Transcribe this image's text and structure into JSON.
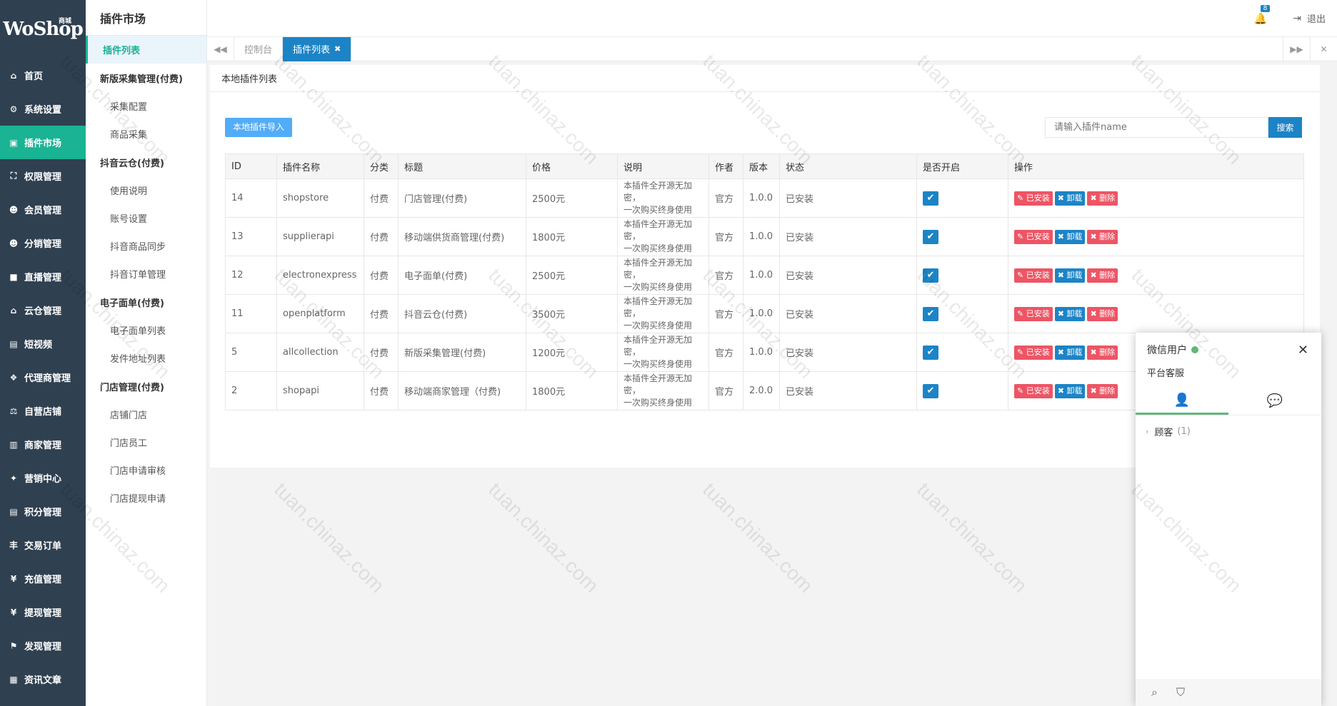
{
  "nav": {
    "logo": "WoShop",
    "logo_tag": "商城",
    "items": [
      {
        "label": "首页",
        "icon": "home-icon",
        "glyph": "⌂"
      },
      {
        "label": "系统设置",
        "icon": "gear-icon",
        "glyph": "⚙"
      },
      {
        "label": "插件市场",
        "icon": "plugin-icon",
        "glyph": "▣"
      },
      {
        "label": "权限管理",
        "icon": "sitemap-icon",
        "glyph": "⛶"
      },
      {
        "label": "会员管理",
        "icon": "users-icon",
        "glyph": "☻"
      },
      {
        "label": "分销管理",
        "icon": "users-icon",
        "glyph": "☻"
      },
      {
        "label": "直播管理",
        "icon": "video-icon",
        "glyph": "■"
      },
      {
        "label": "云仓管理",
        "icon": "home-icon",
        "glyph": "⌂"
      },
      {
        "label": "短视频",
        "icon": "file-icon",
        "glyph": "▤"
      },
      {
        "label": "代理商管理",
        "icon": "cubes-icon",
        "glyph": "❖"
      },
      {
        "label": "自营店铺",
        "icon": "balance-icon",
        "glyph": "⚖"
      },
      {
        "label": "商家管理",
        "icon": "bank-icon",
        "glyph": "▥"
      },
      {
        "label": "营销中心",
        "icon": "tag-icon",
        "glyph": "✦"
      },
      {
        "label": "积分管理",
        "icon": "file-icon",
        "glyph": "▤"
      },
      {
        "label": "交易订单",
        "icon": "yen-icon",
        "glyph": "丰"
      },
      {
        "label": "充值管理",
        "icon": "yen-icon",
        "glyph": "¥"
      },
      {
        "label": "提现管理",
        "icon": "yen-icon",
        "glyph": "¥"
      },
      {
        "label": "发现管理",
        "icon": "flag-icon",
        "glyph": "⚑"
      },
      {
        "label": "资讯文章",
        "icon": "newspaper-icon",
        "glyph": "▦"
      }
    ]
  },
  "submenu": {
    "title": "插件市场",
    "active": "插件列表",
    "groups": [
      {
        "title": "新版采集管理(付费)",
        "items": [
          "采集配置",
          "商品采集"
        ]
      },
      {
        "title": "抖音云仓(付费)",
        "items": [
          "使用说明",
          "账号设置",
          "抖音商品同步",
          "抖音订单管理"
        ]
      },
      {
        "title": "电子面单(付费)",
        "items": [
          "电子面单列表",
          "发件地址列表"
        ]
      },
      {
        "title": "门店管理(付费)",
        "items": [
          "店铺门店",
          "门店员工",
          "门店申请审核",
          "门店提现申请"
        ]
      }
    ]
  },
  "topbar": {
    "badge": "8",
    "logout": "退出"
  },
  "tabs": [
    {
      "label": "控制台"
    },
    {
      "label": "插件列表"
    }
  ],
  "content": {
    "title": "本地插件列表",
    "import_button": "本地插件导入",
    "search_placeholder": "请输入插件name",
    "search_button": "搜索",
    "columns": [
      "ID",
      "插件名称",
      "分类",
      "标题",
      "价格",
      "说明",
      "作者",
      "版本",
      "状态",
      "是否开启",
      "操作"
    ],
    "actions": {
      "installed": "已安装",
      "uninstall": "卸载",
      "delete": "删除"
    },
    "rows": [
      {
        "id": "14",
        "name": "shopstore",
        "cat": "付费",
        "title": "门店管理(付费)",
        "price": "2500元",
        "desc1": "本插件全开源无加密，",
        "desc2": "一次购买终身使用",
        "author": "官方",
        "version": "1.0.0",
        "status": "已安装"
      },
      {
        "id": "13",
        "name": "supplierapi",
        "cat": "付费",
        "title": "移动端供货商管理(付费)",
        "price": "1800元",
        "desc1": "本插件全开源无加密，",
        "desc2": "一次购买终身使用",
        "author": "官方",
        "version": "1.0.0",
        "status": "已安装"
      },
      {
        "id": "12",
        "name": "electronexpress",
        "cat": "付费",
        "title": "电子面单(付费)",
        "price": "2500元",
        "desc1": "本插件全开源无加密，",
        "desc2": "一次购买终身使用",
        "author": "官方",
        "version": "1.0.0",
        "status": "已安装"
      },
      {
        "id": "11",
        "name": "openplatform",
        "cat": "付费",
        "title": "抖音云仓(付费)",
        "price": "3500元",
        "desc1": "本插件全开源无加密，",
        "desc2": "一次购买终身使用",
        "author": "官方",
        "version": "1.0.0",
        "status": "已安装"
      },
      {
        "id": "5",
        "name": "allcollection",
        "cat": "付费",
        "title": "新版采集管理(付费)",
        "price": "1200元",
        "desc1": "本插件全开源无加密，",
        "desc2": "一次购买终身使用",
        "author": "官方",
        "version": "1.0.0",
        "status": "已安装"
      },
      {
        "id": "2",
        "name": "shopapi",
        "cat": "付费",
        "title": "移动端商家管理（付费)",
        "price": "1800元",
        "desc1": "本插件全开源无加密，",
        "desc2": "一次购买终身使用",
        "author": "官方",
        "version": "2.0.0",
        "status": "已安装"
      }
    ]
  },
  "chat": {
    "user": "微信用户",
    "sign": "平台客服",
    "group": "顾客",
    "group_count": "(1)"
  },
  "watermark": "tuan.chinaz.com"
}
